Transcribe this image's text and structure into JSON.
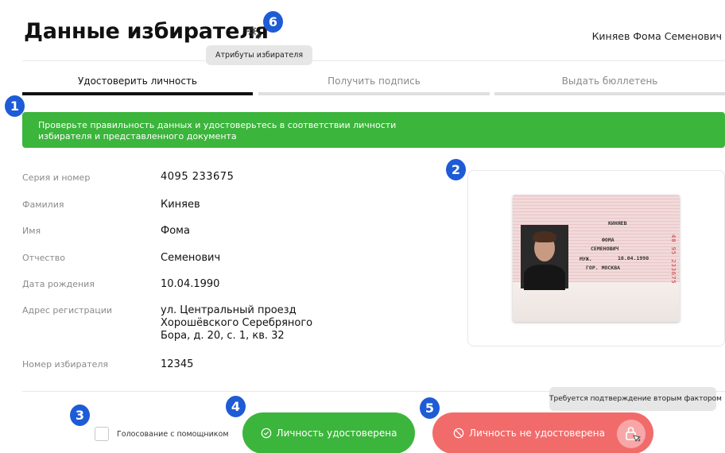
{
  "header": {
    "title": "Данные избирателя",
    "user_name": "Киняев Фома Семенович",
    "gear_tooltip": "Атрибуты избирателя"
  },
  "steps": [
    {
      "label": "Удостоверить личность",
      "active": true
    },
    {
      "label": "Получить подпись",
      "active": false
    },
    {
      "label": "Выдать бюллетень",
      "active": false
    }
  ],
  "banner": {
    "line1": "Проверьте правильность данных и удостоверьтесь в соответствии личности",
    "line2": "избирателя и представленного документа"
  },
  "fields": [
    {
      "label": "Серия и номер",
      "value": "4095 233675"
    },
    {
      "label": "Фамилия",
      "value": "Киняев"
    },
    {
      "label": "Имя",
      "value": "Фома"
    },
    {
      "label": "Отчество",
      "value": "Семенович"
    },
    {
      "label": "Дата рождения",
      "value": "10.04.1990"
    },
    {
      "label": "Адрес регистрации",
      "value_lines": [
        "ул. Центральный проезд",
        "Хорошёвского Серебряного",
        "Бора, д. 20, с. 1, кв. 32"
      ]
    },
    {
      "label": "Номер избирателя",
      "value": "12345"
    }
  ],
  "passport": {
    "surname": "КИНЯЕВ",
    "name": "ФОМА",
    "patronymic": "СЕМЕНОВИЧ",
    "sex": "МУЖ.",
    "dob": "10.04.1990",
    "place": "ГОР. МОСКВА",
    "number": "40 95 233675"
  },
  "footer": {
    "helper_checkbox_label": "Голосование с помощником",
    "confirm_button": "Личность удостоверена",
    "reject_button": "Личность не удостоверена",
    "second_factor_tooltip": "Требуется подтверждение вторым фактором"
  },
  "badges": {
    "b1": "1",
    "b2": "2",
    "b3": "3",
    "b4": "4",
    "b5": "5",
    "b6": "6"
  },
  "colors": {
    "green": "#3cb53c",
    "red": "#f26b6b",
    "badge_blue": "#1e5bd6"
  }
}
